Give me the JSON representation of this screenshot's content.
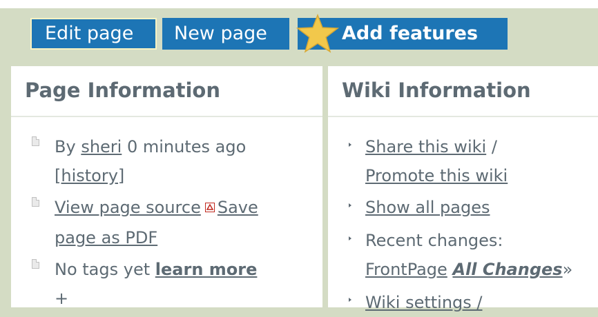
{
  "toolbar": {
    "edit_label": "Edit page",
    "new_label": "New page",
    "add_label": "Add features"
  },
  "page_info": {
    "title": "Page Information",
    "by_prefix": "By",
    "author": "sheri",
    "time": "0 minutes ago",
    "history": "[history]",
    "view_source": "View page source",
    "save_pdf_line1": "Save",
    "save_pdf_line2": "page as PDF",
    "no_tags": "No tags yet",
    "learn_more": "learn more",
    "plus": "+"
  },
  "wiki_info": {
    "title": "Wiki Information",
    "share": "Share this wiki",
    "slash": "/",
    "promote": "Promote this wiki",
    "show_all": "Show all pages",
    "recent_changes": "Recent changes:",
    "front_page": "FrontPage",
    "all_changes": "All Changes",
    "all_changes_suffix": "»",
    "settings": "Wiki settings /"
  },
  "colors": {
    "button_blue": "#1d75b5",
    "toolbar_bg": "#d4dcc4",
    "text_gray": "#5d6a73",
    "star_yellow": "#f2c84b"
  },
  "icons": [
    "star-icon",
    "page-icon",
    "pdf-icon",
    "bullet-icon"
  ]
}
